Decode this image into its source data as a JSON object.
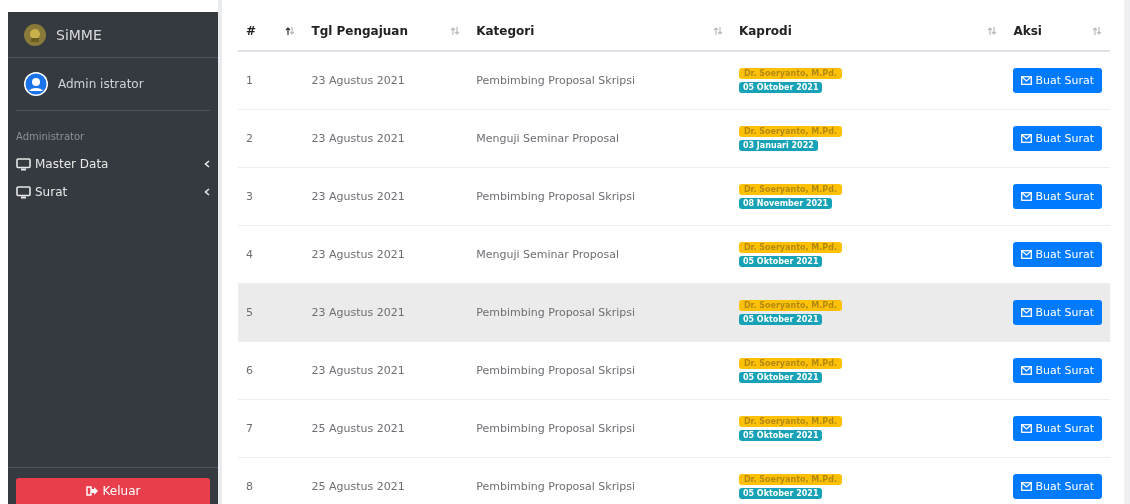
{
  "sidebar": {
    "brand": "SiMME",
    "user": "Admin istrator",
    "section_header": "Administrator",
    "items": [
      {
        "label": "Master Data",
        "expanded": false
      },
      {
        "label": "Surat",
        "expanded": false
      }
    ],
    "logout_button": "Keluar"
  },
  "table": {
    "columns": [
      {
        "label": "#",
        "sorted": true
      },
      {
        "label": "Tgl Pengajuan",
        "sorted": false
      },
      {
        "label": "Kategori",
        "sorted": false
      },
      {
        "label": "Kaprodi",
        "sorted": false
      },
      {
        "label": "Aksi",
        "sorted": false
      }
    ],
    "rows": [
      {
        "no": "1",
        "date": "23 Agustus 2021",
        "category": "Pembimbing Proposal Skripsi",
        "kaprodi": "Dr. Soeryanto, M.Pd.",
        "approved_date": "05 Oktober 2021",
        "action": "Buat Surat",
        "highlighted": false
      },
      {
        "no": "2",
        "date": "23 Agustus 2021",
        "category": "Menguji Seminar Proposal",
        "kaprodi": "Dr. Soeryanto, M.Pd.",
        "approved_date": "03 Januari 2022",
        "action": "Buat Surat",
        "highlighted": false
      },
      {
        "no": "3",
        "date": "23 Agustus 2021",
        "category": "Pembimbing Proposal Skripsi",
        "kaprodi": "Dr. Soeryanto, M.Pd.",
        "approved_date": "08 November 2021",
        "action": "Buat Surat",
        "highlighted": false
      },
      {
        "no": "4",
        "date": "23 Agustus 2021",
        "category": "Menguji Seminar Proposal",
        "kaprodi": "Dr. Soeryanto, M.Pd.",
        "approved_date": "05 Oktober 2021",
        "action": "Buat Surat",
        "highlighted": false
      },
      {
        "no": "5",
        "date": "23 Agustus 2021",
        "category": "Pembimbing Proposal Skripsi",
        "kaprodi": "Dr. Soeryanto, M.Pd.",
        "approved_date": "05 Oktober 2021",
        "action": "Buat Surat",
        "highlighted": true
      },
      {
        "no": "6",
        "date": "23 Agustus 2021",
        "category": "Pembimbing Proposal Skripsi",
        "kaprodi": "Dr. Soeryanto, M.Pd.",
        "approved_date": "05 Oktober 2021",
        "action": "Buat Surat",
        "highlighted": false
      },
      {
        "no": "7",
        "date": "25 Agustus 2021",
        "category": "Pembimbing Proposal Skripsi",
        "kaprodi": "Dr. Soeryanto, M.Pd.",
        "approved_date": "05 Oktober 2021",
        "action": "Buat Surat",
        "highlighted": false
      },
      {
        "no": "8",
        "date": "25 Agustus 2021",
        "category": "Pembimbing Proposal Skripsi",
        "kaprodi": "Dr. Soeryanto, M.Pd.",
        "approved_date": "05 Oktober 2021",
        "action": "Buat Surat",
        "highlighted": false
      }
    ]
  }
}
